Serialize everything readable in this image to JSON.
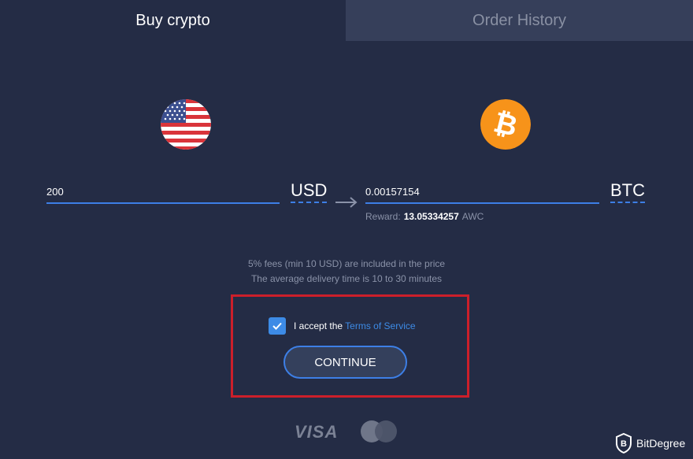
{
  "tabs": [
    {
      "label": "Buy crypto",
      "active": true
    },
    {
      "label": "Order History",
      "active": false
    }
  ],
  "exchange": {
    "from": {
      "amount": "200",
      "currency": "USD",
      "icon": "usa-flag-icon"
    },
    "to": {
      "amount": "0.00157154",
      "currency": "BTC",
      "icon": "bitcoin-icon"
    },
    "reward": {
      "label": "Reward:",
      "value": "13.05334257",
      "unit": "AWC"
    }
  },
  "info": {
    "fees": "5% fees (min 10 USD) are included in the price",
    "delivery": "The average delivery time is 10 to 30 minutes"
  },
  "terms": {
    "checked": true,
    "prefix": "I accept the",
    "link_text": "Terms of Service"
  },
  "continue_label": "CONTINUE",
  "payment_methods": {
    "visa": "VISA",
    "mastercard": "mastercard-icon"
  },
  "watermark": {
    "brand": "BitDegree"
  },
  "colors": {
    "accent": "#3d8be6",
    "background": "#242c45",
    "highlight": "#cc1f2a"
  }
}
